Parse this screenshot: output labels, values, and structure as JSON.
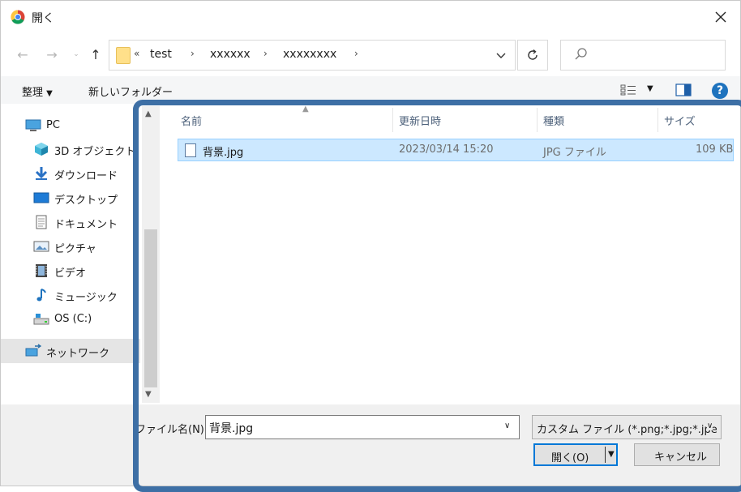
{
  "window": {
    "title": "開く",
    "colors": {
      "accent": "#0078d7",
      "highlight_frame": "#3d6fa5",
      "selection": "#cce8ff"
    }
  },
  "address": {
    "overflow_glyph": "«",
    "path": [
      "test",
      "xxxxxx",
      "xxxxxxxx"
    ]
  },
  "search": {
    "placeholder": ""
  },
  "commandbar": {
    "organize_label": "整理",
    "new_folder_label": "新しいフォルダー"
  },
  "sidebar": {
    "items": [
      {
        "label": "PC",
        "icon": "pc-icon"
      },
      {
        "label": "3D オブジェクト",
        "icon": "3d-objects-icon"
      },
      {
        "label": "ダウンロード",
        "icon": "download-icon"
      },
      {
        "label": "デスクトップ",
        "icon": "desktop-icon"
      },
      {
        "label": "ドキュメント",
        "icon": "documents-icon"
      },
      {
        "label": "ピクチャ",
        "icon": "pictures-icon"
      },
      {
        "label": "ビデオ",
        "icon": "videos-icon"
      },
      {
        "label": "ミュージック",
        "icon": "music-icon"
      },
      {
        "label": "OS (C:)",
        "icon": "drive-icon"
      },
      {
        "label": "ネットワーク",
        "icon": "network-icon"
      }
    ]
  },
  "filelist": {
    "columns": [
      "名前",
      "更新日時",
      "種類",
      "サイズ"
    ],
    "rows": [
      {
        "name": "背景.jpg",
        "modified": "2023/03/14 15:20",
        "type": "JPG ファイル",
        "size": "109 KB"
      }
    ]
  },
  "footer": {
    "filename_label": "ファイル名(N):",
    "filename_value": "背景.jpg",
    "filetype_value": "カスタム ファイル (*.png;*.jpg;*.jpe",
    "open_label": "開く(O)",
    "cancel_label": "キャンセル"
  }
}
